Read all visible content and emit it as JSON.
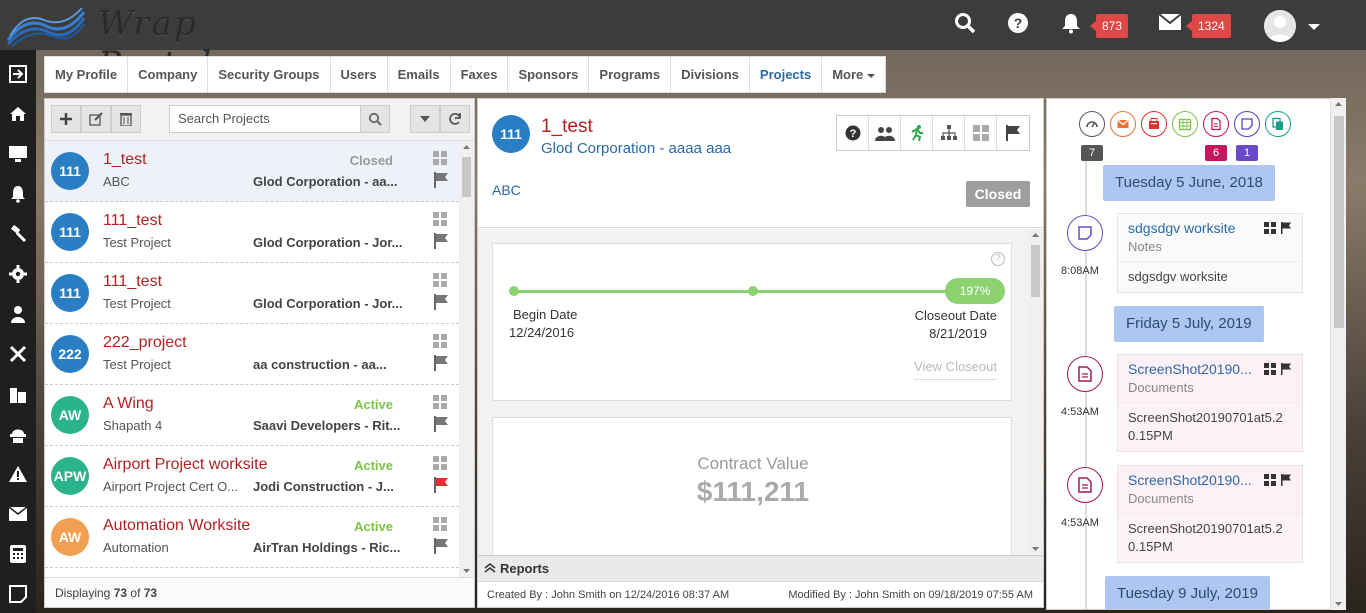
{
  "app": {
    "name": "Wrap Portal",
    "notifications_count": "873",
    "messages_count": "1324"
  },
  "nav_tabs": [
    {
      "label": "My Profile"
    },
    {
      "label": "Company"
    },
    {
      "label": "Security Groups"
    },
    {
      "label": "Users"
    },
    {
      "label": "Emails"
    },
    {
      "label": "Faxes"
    },
    {
      "label": "Sponsors"
    },
    {
      "label": "Programs"
    },
    {
      "label": "Divisions"
    },
    {
      "label": "Projects",
      "active": true
    },
    {
      "label": "More"
    }
  ],
  "sidebar_icons": [
    "sign-in-icon",
    "home-icon",
    "monitor-icon",
    "bell-icon",
    "gavel-icon",
    "gear-icon",
    "user-icon",
    "tools-icon",
    "building-icon",
    "hardhat-icon",
    "warning-icon",
    "envelope-icon",
    "calculator-icon",
    "note-icon"
  ],
  "project_list": {
    "search_placeholder": "Search Projects",
    "footer_prefix": "Displaying ",
    "footer_shown": "73",
    "footer_of": " of ",
    "footer_total": "73",
    "rows": [
      {
        "initials": "111",
        "color": "#2a7fc4",
        "name": "1_test",
        "sub": "ABC",
        "status": "Closed",
        "status_color": "#999999",
        "org": "Glod Corporation - aa...",
        "flag_color": "#777777"
      },
      {
        "initials": "111",
        "color": "#2a7fc4",
        "name": "111_test",
        "sub": "Test Project",
        "status": "",
        "status_color": "#999999",
        "org": "Glod Corporation - Jor...",
        "flag_color": "#777777"
      },
      {
        "initials": "111",
        "color": "#2a7fc4",
        "name": "111_test",
        "sub": "Test Project",
        "status": "",
        "status_color": "#999999",
        "org": "Glod Corporation - Jor...",
        "flag_color": "#777777"
      },
      {
        "initials": "222",
        "color": "#2a7fc4",
        "name": "222_project",
        "sub": "Test Project",
        "status": "",
        "status_color": "#999999",
        "org": "aa construction - aa...",
        "flag_color": "#777777"
      },
      {
        "initials": "AW",
        "color": "#2bb38a",
        "name": "A Wing",
        "sub": "Shapath 4",
        "status": "Active",
        "status_color": "#7cc44a",
        "org": "Saavi Developers - Rit...",
        "flag_color": "#777777"
      },
      {
        "initials": "APW",
        "color": "#2bb38a",
        "name": "Airport Project worksite",
        "sub": "Airport Project Cert O...",
        "status": "Active",
        "status_color": "#7cc44a",
        "org": "Jodi Construction - J...",
        "flag_color": "#e03030"
      },
      {
        "initials": "AW",
        "color": "#f0a050",
        "name": "Automation Worksite",
        "sub": "Automation",
        "status": "Active",
        "status_color": "#7cc44a",
        "org": "AirTran Holdings - Ric...",
        "flag_color": "#777777"
      },
      {
        "initials": "",
        "color": "#2a7fc4",
        "name": "",
        "sub": "",
        "status": "",
        "status_color": "#999999",
        "org": "",
        "flag_color": "#777777"
      }
    ]
  },
  "detail": {
    "initials": "111",
    "title": "1_test",
    "subtitle": "Glod Corporation - aaaa aaa",
    "description": "ABC",
    "status": "Closed",
    "progress_label": "197%",
    "progress_percent": 197,
    "begin_label": "Begin Date",
    "begin_date": "12/24/2016",
    "closeout_label": "Closeout Date",
    "closeout_date": "8/21/2019",
    "view_closeout": "View Closeout",
    "contract_label": "Contract Value",
    "contract_value": "$111,211",
    "reports_label": "Reports",
    "created_by": "Created By : John Smith on 12/24/2016 08:37 AM",
    "modified_by": "Modified By : John Smith on 09/18/2019 07:55 AM",
    "help_glyph": "?"
  },
  "activity": {
    "filters": [
      {
        "icon": "dashboard-icon",
        "color": "#555555",
        "count": "7"
      },
      {
        "icon": "email-icon",
        "color": "#e8743b",
        "count": ""
      },
      {
        "icon": "fax-icon",
        "color": "#e03030",
        "count": ""
      },
      {
        "icon": "calendar-icon",
        "color": "#7cc44a",
        "count": ""
      },
      {
        "icon": "document-icon",
        "color": "#c2185b",
        "count": "6"
      },
      {
        "icon": "note-icon",
        "color": "#5b3fc4",
        "count": "1"
      },
      {
        "icon": "copy-icon",
        "color": "#1aa08a",
        "count": ""
      }
    ],
    "dates": [
      "Tuesday 5 June, 2018",
      "Friday 5 July, 2019",
      "Tuesday 9 July, 2019"
    ],
    "items": [
      {
        "time": "8:08AM",
        "title": "sdgsdgv worksite",
        "category": "Notes",
        "body": "sdgsdgv worksite",
        "color": "#6a4ac8"
      },
      {
        "time": "4:53AM",
        "title": "ScreenShot20190...",
        "category": "Documents",
        "body": "ScreenShot20190701at5.20.15PM",
        "color": "#a3195b"
      },
      {
        "time": "4:53AM",
        "title": "ScreenShot20190...",
        "category": "Documents",
        "body": "ScreenShot20190701at5.20.15PM",
        "color": "#a3195b"
      }
    ]
  }
}
